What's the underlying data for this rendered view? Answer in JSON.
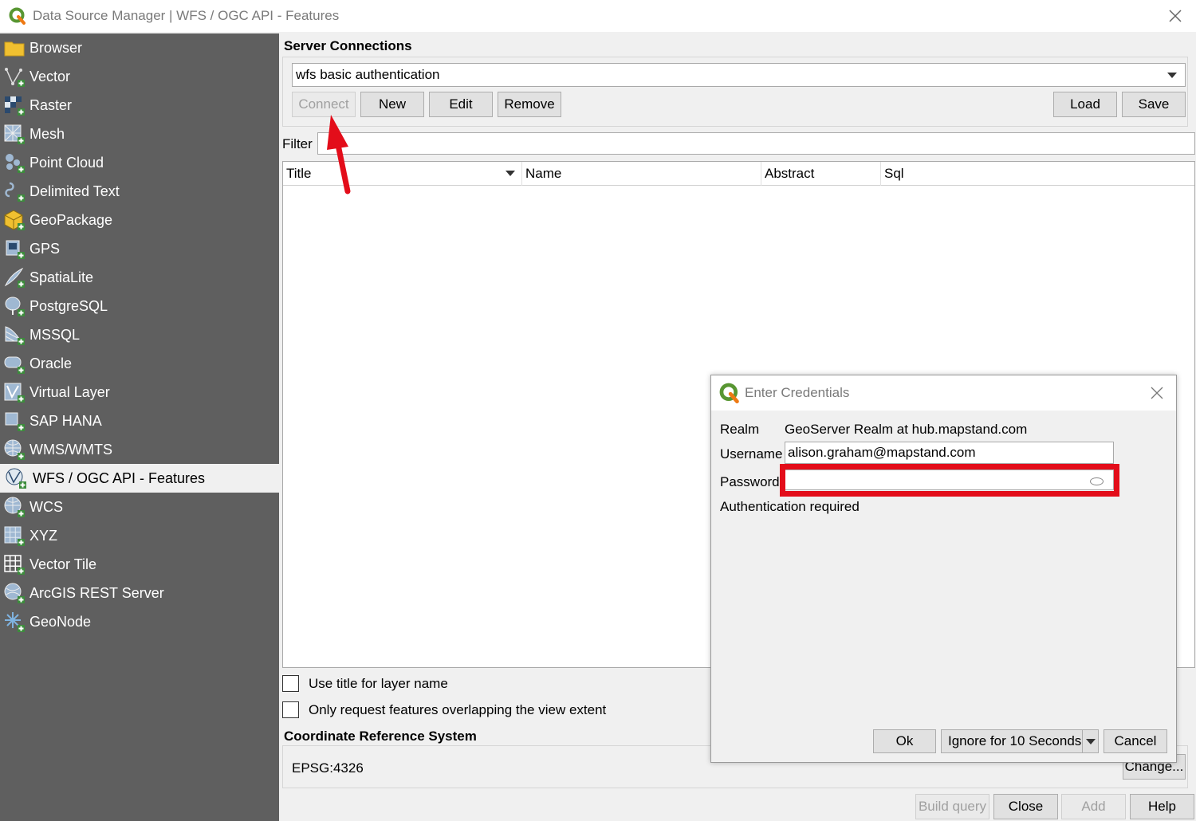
{
  "window": {
    "title": "Data Source Manager | WFS / OGC API - Features"
  },
  "sidebar": {
    "items": [
      {
        "label": "Browser",
        "icon": "folder-icon"
      },
      {
        "label": "Vector",
        "icon": "vector-icon"
      },
      {
        "label": "Raster",
        "icon": "raster-icon"
      },
      {
        "label": "Mesh",
        "icon": "mesh-icon"
      },
      {
        "label": "Point Cloud",
        "icon": "point-cloud-icon"
      },
      {
        "label": "Delimited Text",
        "icon": "delimited-text-icon"
      },
      {
        "label": "GeoPackage",
        "icon": "geopackage-icon"
      },
      {
        "label": "GPS",
        "icon": "gps-icon"
      },
      {
        "label": "SpatiaLite",
        "icon": "spatialite-icon"
      },
      {
        "label": "PostgreSQL",
        "icon": "postgresql-icon"
      },
      {
        "label": "MSSQL",
        "icon": "mssql-icon"
      },
      {
        "label": "Oracle",
        "icon": "oracle-icon"
      },
      {
        "label": "Virtual Layer",
        "icon": "virtual-layer-icon"
      },
      {
        "label": "SAP HANA",
        "icon": "sap-hana-icon"
      },
      {
        "label": "WMS/WMTS",
        "icon": "wms-icon"
      },
      {
        "label": "WFS / OGC API - Features",
        "icon": "wfs-icon",
        "active": true
      },
      {
        "label": "WCS",
        "icon": "wcs-icon"
      },
      {
        "label": "XYZ",
        "icon": "xyz-icon"
      },
      {
        "label": "Vector Tile",
        "icon": "vector-tile-icon"
      },
      {
        "label": "ArcGIS REST Server",
        "icon": "arcgis-icon"
      },
      {
        "label": "GeoNode",
        "icon": "geonode-icon"
      }
    ]
  },
  "server_connections": {
    "title": "Server Connections",
    "selected": "wfs basic authentication",
    "buttons": {
      "connect": "Connect",
      "new": "New",
      "edit": "Edit",
      "remove": "Remove",
      "load": "Load",
      "save": "Save"
    }
  },
  "filter": {
    "label": "Filter",
    "value": ""
  },
  "table": {
    "columns": [
      "Title",
      "Name",
      "Abstract",
      "Sql"
    ]
  },
  "options": {
    "use_title": "Use title for layer name",
    "only_request": "Only request features overlapping the view extent"
  },
  "crs": {
    "title": "Coordinate Reference System",
    "value": "EPSG:4326",
    "change": "Change..."
  },
  "footer": {
    "build_query": "Build query",
    "close": "Close",
    "add": "Add",
    "help": "Help"
  },
  "credentials_dialog": {
    "title": "Enter Credentials",
    "realm_label": "Realm",
    "realm_value": "GeoServer Realm at hub.mapstand.com",
    "username_label": "Username",
    "username_value": "alison.graham@mapstand.com",
    "password_label": "Password",
    "password_value": "",
    "status": "Authentication required",
    "ok": "Ok",
    "ignore": "Ignore for 10 Seconds",
    "cancel": "Cancel"
  },
  "colors": {
    "sidebar_bg": "#5f5f5f",
    "annotation_red": "#e30d1a",
    "qgis_green": "#589632"
  }
}
